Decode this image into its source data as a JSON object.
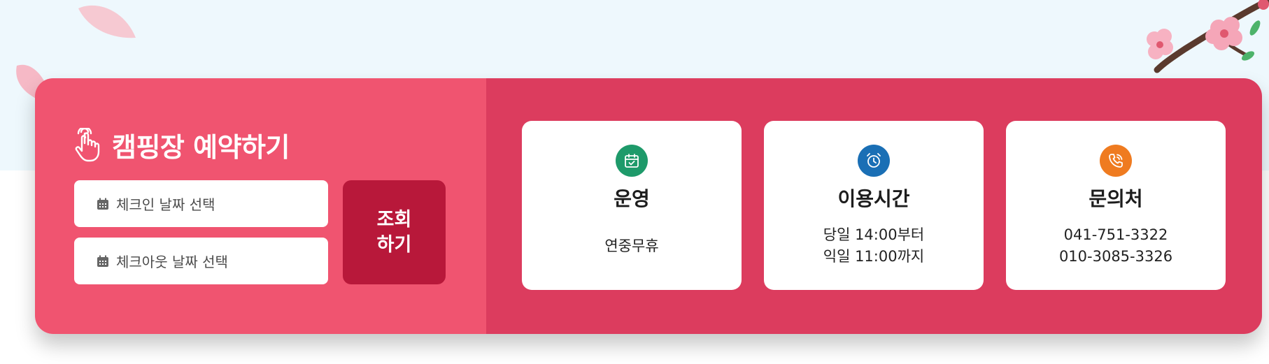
{
  "colors": {
    "sky": "#eef8fd",
    "left_panel": "#f05470",
    "right_panel": "#dc3c5e",
    "search_button": "#b8183a",
    "icon_operation": "#1e9a6a",
    "icon_hours": "#1a6fb5",
    "icon_contact": "#ef7b20"
  },
  "reservation": {
    "title": "캠핑장 예약하기",
    "title_icon": "pointer-hand-icon",
    "checkin_placeholder": "체크인 날짜 선택",
    "checkout_placeholder": "체크아웃 날짜 선택",
    "field_icon": "calendar-icon",
    "search_label": "조회\n하기"
  },
  "info_cards": [
    {
      "icon": "calendar-check-icon",
      "heading": "운영",
      "lines": [
        "연중무휴"
      ]
    },
    {
      "icon": "alarm-clock-icon",
      "heading": "이용시간",
      "lines": [
        "당일 14:00부터",
        "익일 11:00까지"
      ]
    },
    {
      "icon": "phone-call-icon",
      "heading": "문의처",
      "lines": [
        "041-751-3322",
        "010-3085-3326"
      ]
    }
  ]
}
